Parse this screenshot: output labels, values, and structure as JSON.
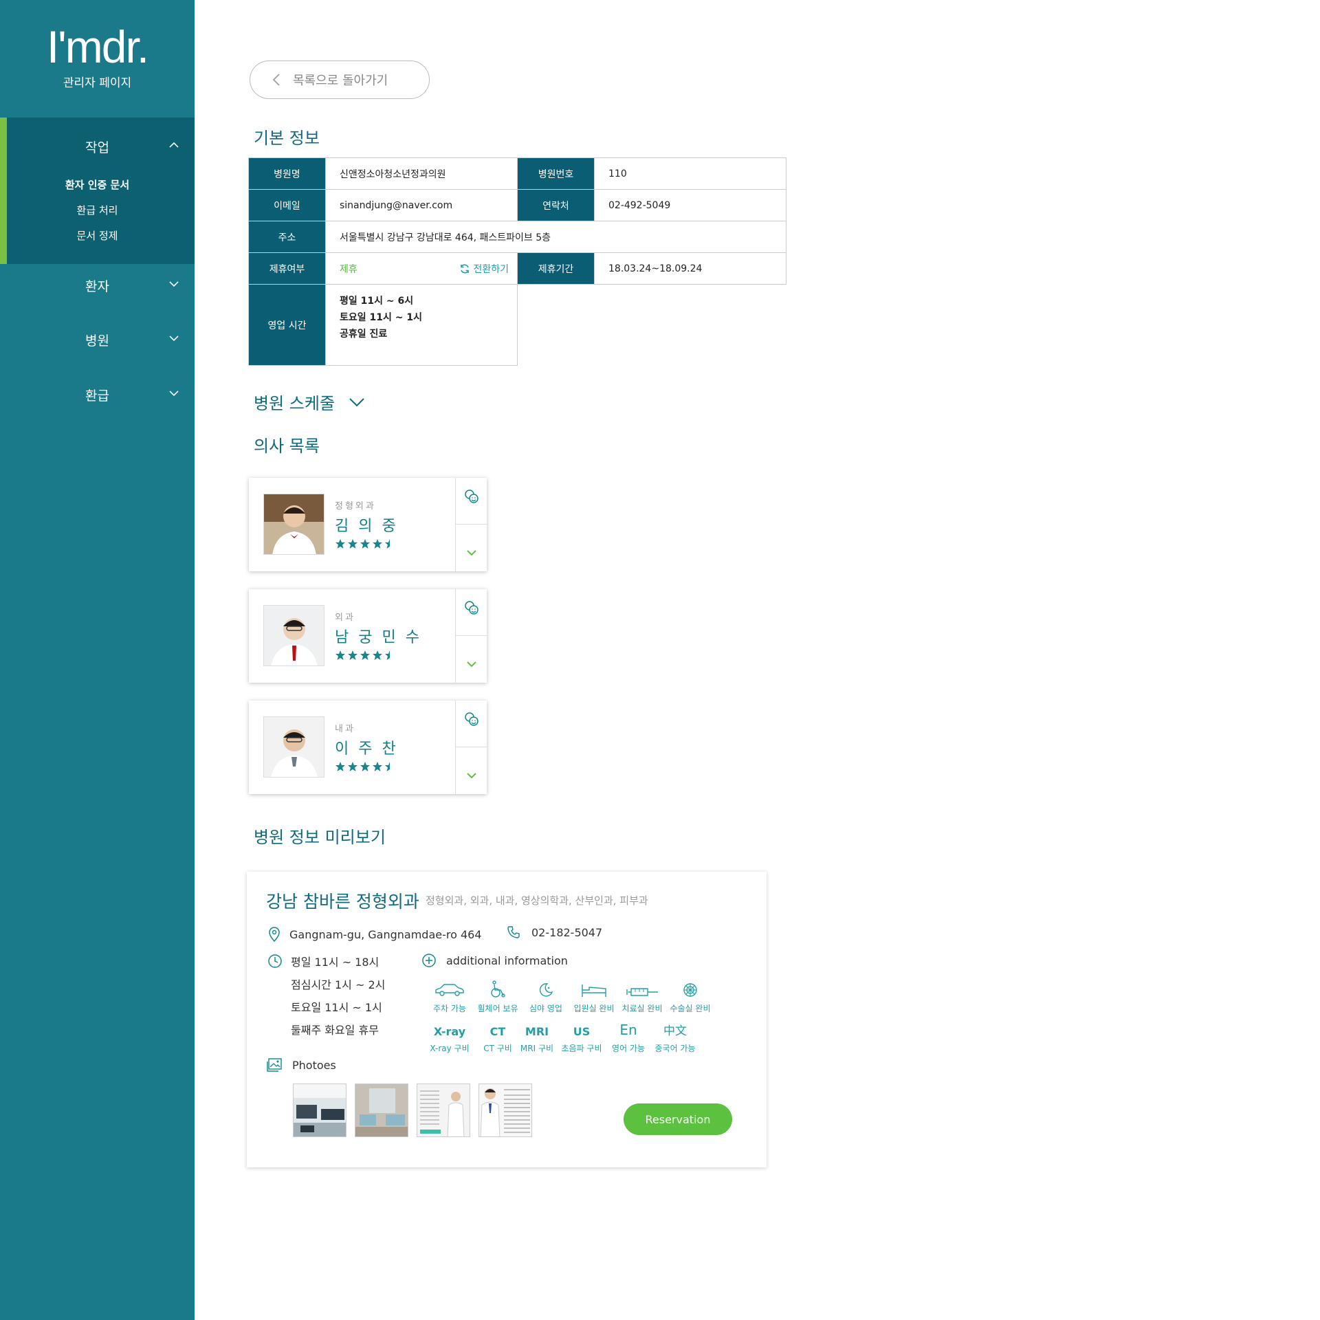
{
  "sidebar": {
    "logo": "I'mdr.",
    "subtitle": "관리자 페이지",
    "menus": [
      {
        "label": "작업",
        "items": [
          "환자 인증 문서",
          "환급 처리",
          "문서 정제"
        ]
      },
      {
        "label": "환자"
      },
      {
        "label": "병원"
      },
      {
        "label": "환급"
      }
    ]
  },
  "back_label": "목록으로 돌아가기",
  "basic": {
    "title": "기본 정보",
    "name_label": "병원명",
    "name": "신앤정소아청소년정과의원",
    "no_label": "병원번호",
    "no": "110",
    "email_label": "이메일",
    "email": "sinandjung@naver.com",
    "phone_label": "연락처",
    "phone": "02-492-5049",
    "addr_label": "주소",
    "addr": "서울특별시 강남구 강남대로 464, 패스트파이브 5층",
    "partner_label": "제휴여부",
    "partner": "제휴",
    "switch": "전환하기",
    "period_label": "제휴기간",
    "period": "18.03.24~18.09.24",
    "hours_label": "영업 시간",
    "hours": [
      "평일 11시 ~ 6시",
      "토요일 11시 ~ 1시",
      "공휴일 진료"
    ]
  },
  "schedule_title": "병원 스케줄",
  "doctors_title": "의사 목록",
  "doctors": [
    {
      "dept": "정형외과",
      "name": "김의중",
      "rating": 4.5
    },
    {
      "dept": "외과",
      "name": "남궁민수",
      "rating": 4.5
    },
    {
      "dept": "내과",
      "name": "이주찬",
      "rating": 4.5
    }
  ],
  "preview": {
    "title": "병원 정보 미리보기",
    "name": "강남 참바른 정형외과",
    "depts": "정형외과, 외과, 내과, 영상의학과, 산부인과, 피부과",
    "address": "Gangnam-gu, Gangnamdae-ro 464",
    "phone": "02-182-5047",
    "hours": [
      "평일 11시 ~ 18시",
      "점심시간 1시 ~ 2시",
      "토요일 11시 ~ 1시",
      "둘째주 화요일 휴무"
    ],
    "additional": "additional information",
    "features": [
      "주차 가능",
      "휠체어 보유",
      "심야 영업",
      "입원실 완비",
      "치료실 완비",
      "수술실 완비"
    ],
    "equipment": [
      {
        "icon": "X-ray",
        "label": "X-ray 구비"
      },
      {
        "icon": "CT",
        "label": "CT 구비"
      },
      {
        "icon": "MRI",
        "label": "MRI 구비"
      },
      {
        "icon": "US",
        "label": "초음파 구비"
      },
      {
        "icon": "En",
        "label": "영어 가능"
      },
      {
        "icon": "中文",
        "label": "중국어 가능"
      }
    ],
    "photos_label": "Photoes",
    "reserve": "Reservation"
  },
  "colors": {
    "sidebar": "#1a7a8a",
    "accent": "#0e6a7e",
    "green": "#5bc13f",
    "header_cell": "#0b5d73"
  }
}
